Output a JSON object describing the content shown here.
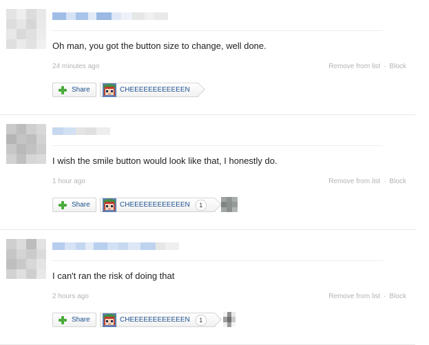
{
  "posts": [
    {
      "comment": "Oh man, you got the button size to change, well done.",
      "time": "24 minutes ago",
      "remove_label": "Remove from list",
      "block_label": "Block",
      "share_label": "Share",
      "emote_label": "CHEEEEEEEEEEEEN",
      "emote_count": ""
    },
    {
      "comment": "I wish the smile button would look like that, I honestly do.",
      "time": "1 hour ago",
      "remove_label": "Remove from list",
      "block_label": "Block",
      "share_label": "Share",
      "emote_label": "CHEEEEEEEEEEEEN",
      "emote_count": "1"
    },
    {
      "comment": "I can't ran the risk of doing that",
      "time": "2 hours ago",
      "remove_label": "Remove from list",
      "block_label": "Block",
      "share_label": "Share",
      "emote_label": "CHEEEEEEEEEEEEN",
      "emote_count": "1"
    }
  ],
  "separator_dot": "·",
  "icons": {
    "share": "plus-icon",
    "emote": "character-face-icon"
  },
  "colors": {
    "link_blue": "#1c4f8c",
    "share_green": "#4bab3c",
    "meta_gray": "#b3b3b3"
  }
}
